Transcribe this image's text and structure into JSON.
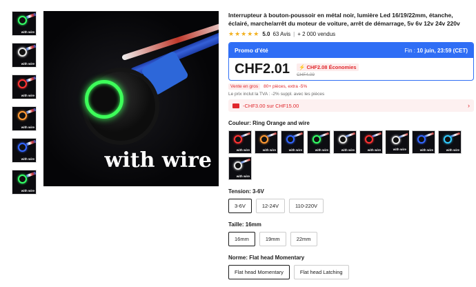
{
  "thumbnails": [
    {
      "label": "with wire",
      "ring": "#33ff66"
    },
    {
      "label": "with wire",
      "ring": "#e6e6e6"
    },
    {
      "label": "with wire",
      "ring": "#ff3333"
    },
    {
      "label": "with wire",
      "ring": "#ff9933"
    },
    {
      "label": "with wire",
      "ring": "#3366ff"
    },
    {
      "label": "with wire",
      "ring": "#33ff66"
    }
  ],
  "main_image": {
    "caption": "with wire",
    "ring": "#3dff5a"
  },
  "product": {
    "title": "Interrupteur à bouton-poussoir en métal noir, lumière Led 16/19/22mm, étanche, éclairé, marche/arrêt du moteur de voiture, arrêt de démarrage, 5v 6v 12v 24v 220v",
    "stars": "★★★★★",
    "rating": "5.0",
    "reviews": "63 Avis",
    "separator": "|",
    "sold": "+ 2 000 vendus"
  },
  "promo": {
    "title": "Promo d'été",
    "deadline_prefix": "Fin :",
    "deadline": "10 juin, 23:59 (CET)",
    "price": "CHF2.01",
    "savings": "CHF2.08 Économies",
    "original_price": "CHF4.09"
  },
  "bulk": {
    "tag": "Vente en gros",
    "text": "80+ pièces, extra -5%"
  },
  "tva_text": "Le prix inclut la TVA : -2% suppl. avec les pièces",
  "coupon": {
    "text": "-CHF3.00 sur CHF15.00",
    "chevron": "›"
  },
  "color_option": {
    "label": "Couleur: Ring Orange and wire",
    "swatches": [
      {
        "label": "with wire",
        "ring": "#ff3333",
        "selected": false
      },
      {
        "label": "with wire",
        "ring": "#ff9933",
        "selected": false
      },
      {
        "label": "with wire",
        "ring": "#3366ff",
        "selected": false
      },
      {
        "label": "with wire",
        "ring": "#33ff66",
        "selected": false
      },
      {
        "label": "with wire",
        "ring": "#e6e6e6",
        "selected": false
      },
      {
        "label": "with wire",
        "ring": "#ff3333",
        "selected": false
      },
      {
        "label": "with wire",
        "ring": "#e6e6e6",
        "selected": true
      },
      {
        "label": "with wire",
        "ring": "#3366ff",
        "selected": false
      },
      {
        "label": "with wire",
        "ring": "#33ccff",
        "selected": false
      },
      {
        "label": "with wire",
        "ring": "#e6e6e6",
        "selected": false
      }
    ]
  },
  "voltage_option": {
    "label": "Tension: 3-6V",
    "values": [
      "3-6V",
      "12-24V",
      "110-220V"
    ],
    "selected": "3-6V"
  },
  "size_option": {
    "label": "Taille: 16mm",
    "values": [
      "16mm",
      "19mm",
      "22mm"
    ],
    "selected": "16mm"
  },
  "norm_option": {
    "label": "Norme: Flat head Momentary",
    "values": [
      "Flat head Momentary",
      "Flat head Latching"
    ],
    "selected": "Flat head Momentary"
  }
}
